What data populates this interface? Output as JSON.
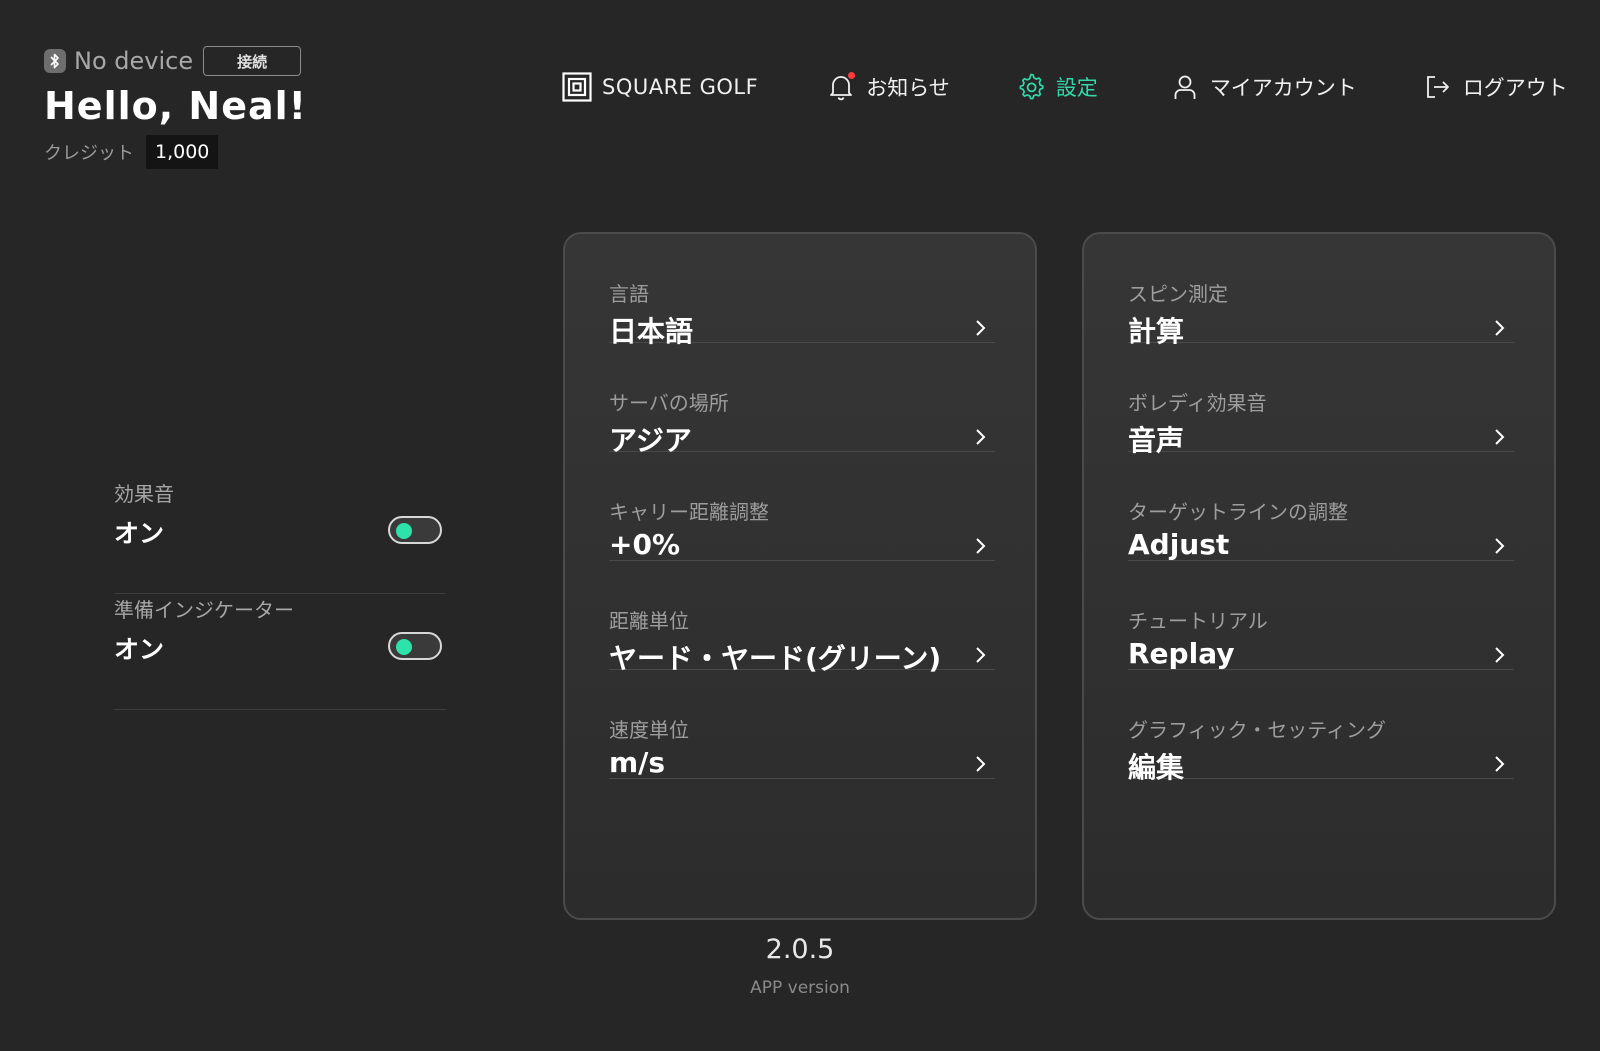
{
  "header": {
    "device_name": "No device",
    "connect_label": "接続",
    "greeting": "Hello, Neal!",
    "credit_label": "クレジット",
    "credit_value": "1,000"
  },
  "nav": {
    "brand": "SQUARE GOLF",
    "notice": "お知らせ",
    "settings": "設定",
    "account": "マイアカウント",
    "logout": "ログアウト",
    "active_color": "#32d8a8"
  },
  "toggles": [
    {
      "label": "効果音",
      "value": "オン",
      "on": true
    },
    {
      "label": "準備インジケーター",
      "value": "オン",
      "on": true
    }
  ],
  "left_panel": [
    {
      "label": "言語",
      "value": "日本語"
    },
    {
      "label": "サーバの場所",
      "value": "アジア"
    },
    {
      "label": "キャリー距離調整",
      "value": "+0%"
    },
    {
      "label": "距離単位",
      "value": "ヤード・ヤード(グリーン)"
    },
    {
      "label": "速度単位",
      "value": "m/s"
    }
  ],
  "right_panel": [
    {
      "label": "スピン測定",
      "value": "計算"
    },
    {
      "label": "ボレディ効果音",
      "value": "音声"
    },
    {
      "label": "ターゲットラインの調整",
      "value": "Adjust"
    },
    {
      "label": "チュートリアル",
      "value": "Replay"
    },
    {
      "label": "グラフィック・セッティング",
      "value": "編集"
    }
  ],
  "app": {
    "version": "2.0.5",
    "version_label": "APP version"
  },
  "colors": {
    "background": "#262626",
    "toggle_on": "#2ee3aa",
    "notification_dot": "#ff3b3b"
  }
}
